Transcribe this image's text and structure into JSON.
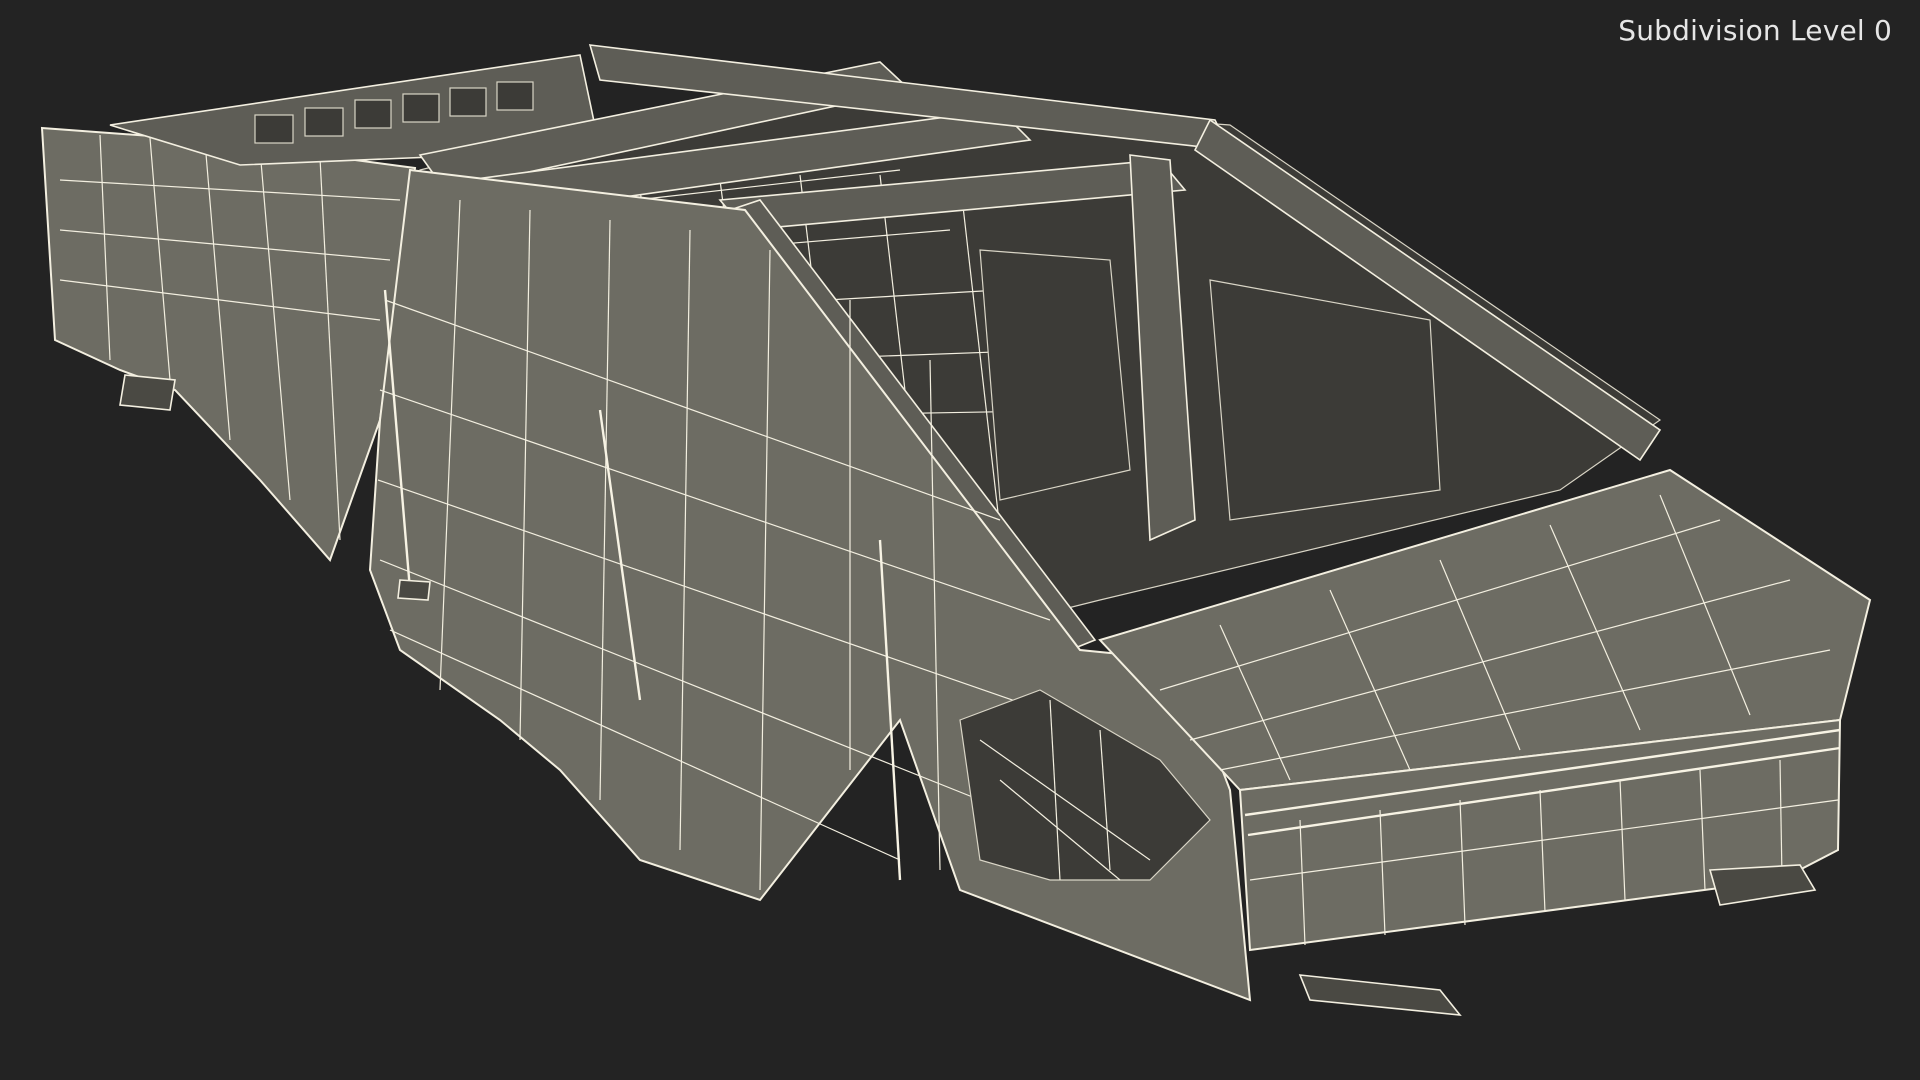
{
  "overlay": {
    "subdivision_label": "Subdivision Level 0"
  },
  "colors": {
    "background": "#232323",
    "body_panel": "#6d6c63",
    "wireframe": "#f3efe0",
    "label_text": "#e6e6e6"
  }
}
